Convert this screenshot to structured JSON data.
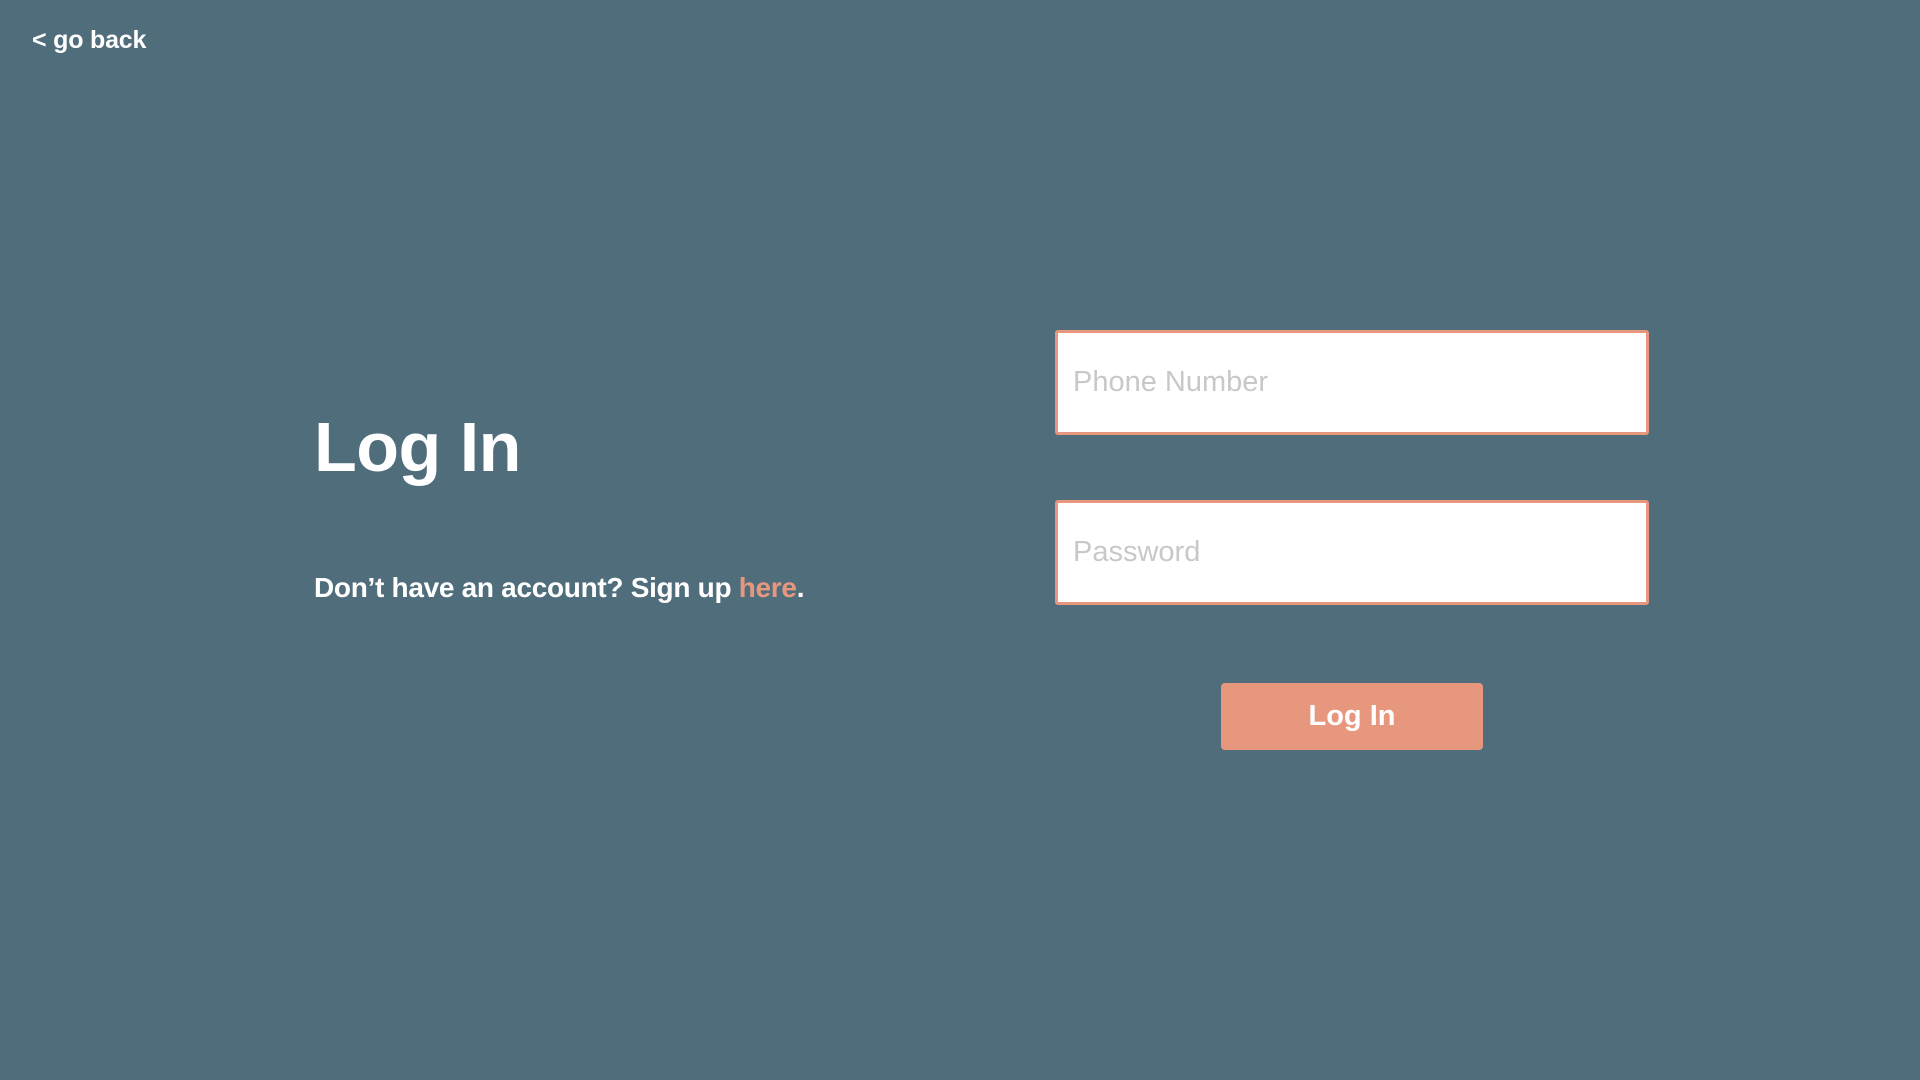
{
  "nav": {
    "back_label": "< go back"
  },
  "login": {
    "title": "Log In",
    "signup_prompt": "Don’t have an account? Sign up ",
    "signup_link": "here",
    "signup_suffix": ".",
    "phone_placeholder": "Phone Number",
    "phone_value": "",
    "password_placeholder": "Password",
    "password_value": "",
    "submit_label": "Log In"
  },
  "colors": {
    "background": "#506d7b",
    "accent": "#e8977f",
    "text": "#ffffff",
    "placeholder": "#c8c8c8"
  }
}
